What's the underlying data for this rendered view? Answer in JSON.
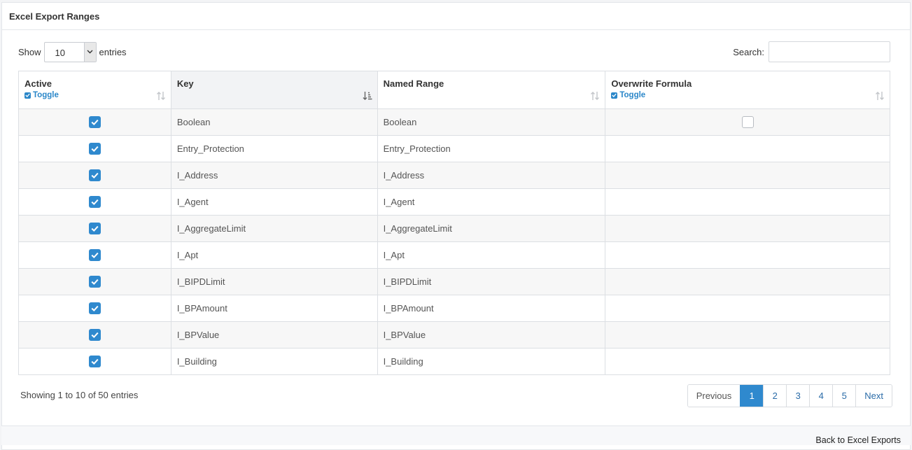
{
  "panel": {
    "title": "Excel Export Ranges"
  },
  "controls": {
    "show_label": "Show",
    "entries_value": "10",
    "entries_label": "entries",
    "search_label": "Search:",
    "search_value": ""
  },
  "columns": [
    {
      "title": "Active",
      "toggle": "Toggle",
      "sort": "both"
    },
    {
      "title": "Key",
      "toggle": "",
      "sort": "asc"
    },
    {
      "title": "Named Range",
      "toggle": "",
      "sort": "both"
    },
    {
      "title": "Overwrite Formula",
      "toggle": "Toggle",
      "sort": "both"
    }
  ],
  "rows": [
    {
      "active": true,
      "key": "Boolean",
      "named_range": "Boolean",
      "overwrite": "unchecked"
    },
    {
      "active": true,
      "key": "Entry_Protection",
      "named_range": "Entry_Protection",
      "overwrite": ""
    },
    {
      "active": true,
      "key": "I_Address",
      "named_range": "I_Address",
      "overwrite": ""
    },
    {
      "active": true,
      "key": "I_Agent",
      "named_range": "I_Agent",
      "overwrite": ""
    },
    {
      "active": true,
      "key": "I_AggregateLimit",
      "named_range": "I_AggregateLimit",
      "overwrite": ""
    },
    {
      "active": true,
      "key": "I_Apt",
      "named_range": "I_Apt",
      "overwrite": ""
    },
    {
      "active": true,
      "key": "I_BIPDLimit",
      "named_range": "I_BIPDLimit",
      "overwrite": ""
    },
    {
      "active": true,
      "key": "I_BPAmount",
      "named_range": "I_BPAmount",
      "overwrite": ""
    },
    {
      "active": true,
      "key": "I_BPValue",
      "named_range": "I_BPValue",
      "overwrite": ""
    },
    {
      "active": true,
      "key": "I_Building",
      "named_range": "I_Building",
      "overwrite": ""
    }
  ],
  "info": "Showing 1 to 10 of 50 entries",
  "pagination": {
    "previous": "Previous",
    "pages": [
      "1",
      "2",
      "3",
      "4",
      "5"
    ],
    "current": "1",
    "next": "Next"
  },
  "footer": {
    "back_link": "Back to Excel Exports"
  },
  "colors": {
    "accent": "#2f89ce",
    "link": "#2b87c9"
  }
}
